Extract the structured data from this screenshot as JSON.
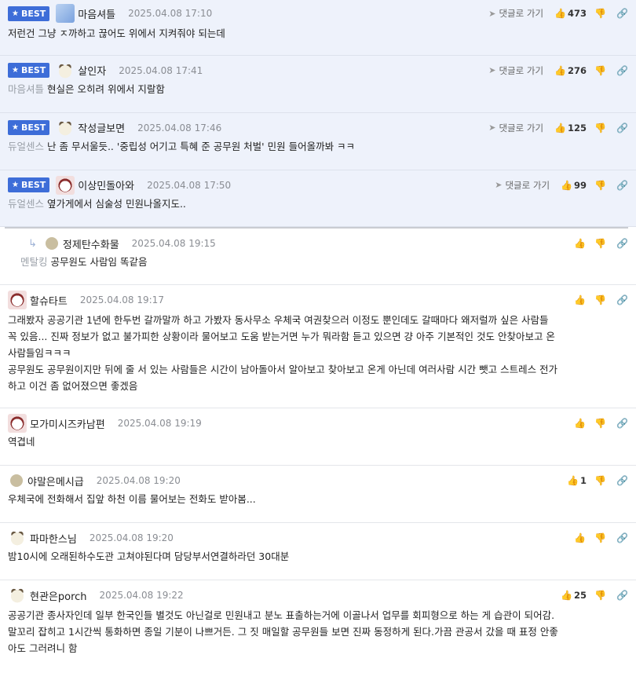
{
  "icons": {
    "reply_arrow": "send-arrow-icon",
    "thumbs_up": "thumbs-up-icon",
    "thumbs_down": "thumbs-down-icon",
    "link": "link-icon",
    "star": "star-icon"
  },
  "colors": {
    "best_badge": "#3d6dd8",
    "best_bg": "#eef2fb",
    "mention": "#9aa0a8"
  },
  "best_label": "BEST",
  "reply_label": "댓글로 가기",
  "comments": [
    {
      "nick": "마음셔틀",
      "date": "2025.04.08 17:10",
      "likes": "473",
      "mention": "",
      "text": "저런건 그냥 ㅈ까하고 끊어도 위에서 지켜줘야 되는데"
    },
    {
      "nick": "살인자",
      "date": "2025.04.08 17:41",
      "likes": "276",
      "mention": "마음셔틀",
      "text": "현실은 오히려 위에서 지랄함"
    },
    {
      "nick": "작성글보면",
      "date": "2025.04.08 17:46",
      "likes": "125",
      "mention": "듀얼센스",
      "text": "난 좀 무서울듯.. '중립성 어기고 특혜 준 공무원 처벌' 민원 들어올까봐 ㅋㅋ"
    },
    {
      "nick": "이상민돌아와",
      "date": "2025.04.08 17:50",
      "likes": "99",
      "mention": "듀얼센스",
      "text": "옆가게에서 심술성 민원나올지도.."
    },
    {
      "nick": "정제탄수화물",
      "date": "2025.04.08 19:15",
      "likes": "",
      "mention": "멘탈킹",
      "text": "공무원도 사람임 똑같음"
    },
    {
      "nick": "할슈타트",
      "date": "2025.04.08 19:17",
      "likes": "",
      "mention": "",
      "lines": [
        "그래봤자 공공기관 1년에 한두번 갈까말까 하고 가봤자 동사무소 우체국 여권찾으러 이정도 뿐인데도 갈때마다 왜저럴까 싶은 사람들",
        "꼭 있음... 진짜 정보가 없고 불가피한 상황이라 물어보고 도움 받는거면 누가 뭐라함 듣고 있으면 걍 아주 기본적인 것도 안찾아보고 온",
        "사람들임ㅋㅋㅋ",
        "공무원도 공무원이지만 뒤에 줄 서 있는 사람들은 시간이 남아돌아서 알아보고 찾아보고 온게 아닌데 여러사람 시간 뺏고 스트레스 전가",
        "하고 이건 좀 없어졌으면 좋겠음"
      ]
    },
    {
      "nick": "모가미시즈카남편",
      "date": "2025.04.08 19:19",
      "likes": "",
      "mention": "",
      "text": "역겹네"
    },
    {
      "nick": "야말은메시급",
      "date": "2025.04.08 19:20",
      "likes": "1",
      "mention": "",
      "text": "우체국에 전화해서 집앞 하천 이름 물어보는 전화도 받아봄..."
    },
    {
      "nick": "파마한스님",
      "date": "2025.04.08 19:20",
      "likes": "",
      "mention": "",
      "text": "밤10시에 오래된하수도관 고쳐야된다며 담당부서연결하라던 30대분"
    },
    {
      "nick": "현관은porch",
      "date": "2025.04.08 19:22",
      "likes": "25",
      "mention": "",
      "lines": [
        "공공기관 종사자인데 일부 한국인들 별것도 아닌걸로 민원내고 분노 표출하는거에 이골나서 업무를 회피형으로 하는 게 습관이 되어감.",
        "말꼬리 잡히고 1시간씩 통화하면 종일 기분이 나쁘거든. 그 짓 매일할 공무원들 보면 진짜 동정하게 된다.가끔 관공서 갔을 때 표정 안좋",
        "아도 그러려니 함"
      ]
    }
  ]
}
